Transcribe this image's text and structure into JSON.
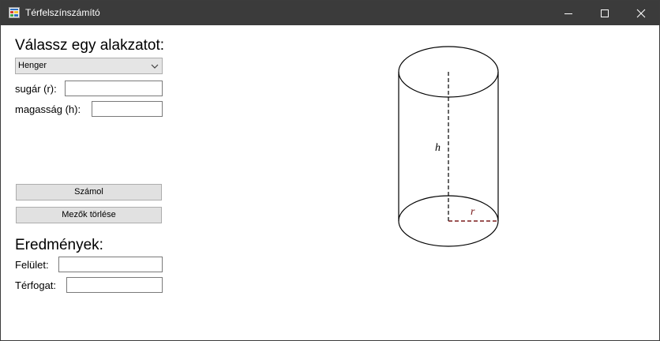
{
  "window": {
    "title": "Térfelszínszámító",
    "icons": {
      "app": "app-icon",
      "minimize": "minimize-icon",
      "maximize": "maximize-icon",
      "close": "close-icon"
    }
  },
  "input_panel": {
    "heading": "Válassz egy alakzatot:",
    "shape_select": {
      "selected": "Henger",
      "icon": "chevron-down-icon"
    },
    "radius_label": "sugár (r):",
    "radius_value": "",
    "height_label": "magasság (h):",
    "height_value": ""
  },
  "actions": {
    "calculate_label": "Számol",
    "clear_label": "Mezők törlése"
  },
  "results": {
    "heading": "Eredmények:",
    "surface_label": "Felület:",
    "surface_value": "",
    "volume_label": "Térfogat:",
    "volume_value": ""
  },
  "diagram": {
    "height_symbol": "h",
    "radius_symbol": "r",
    "radius_color": "#7a1c1c"
  }
}
